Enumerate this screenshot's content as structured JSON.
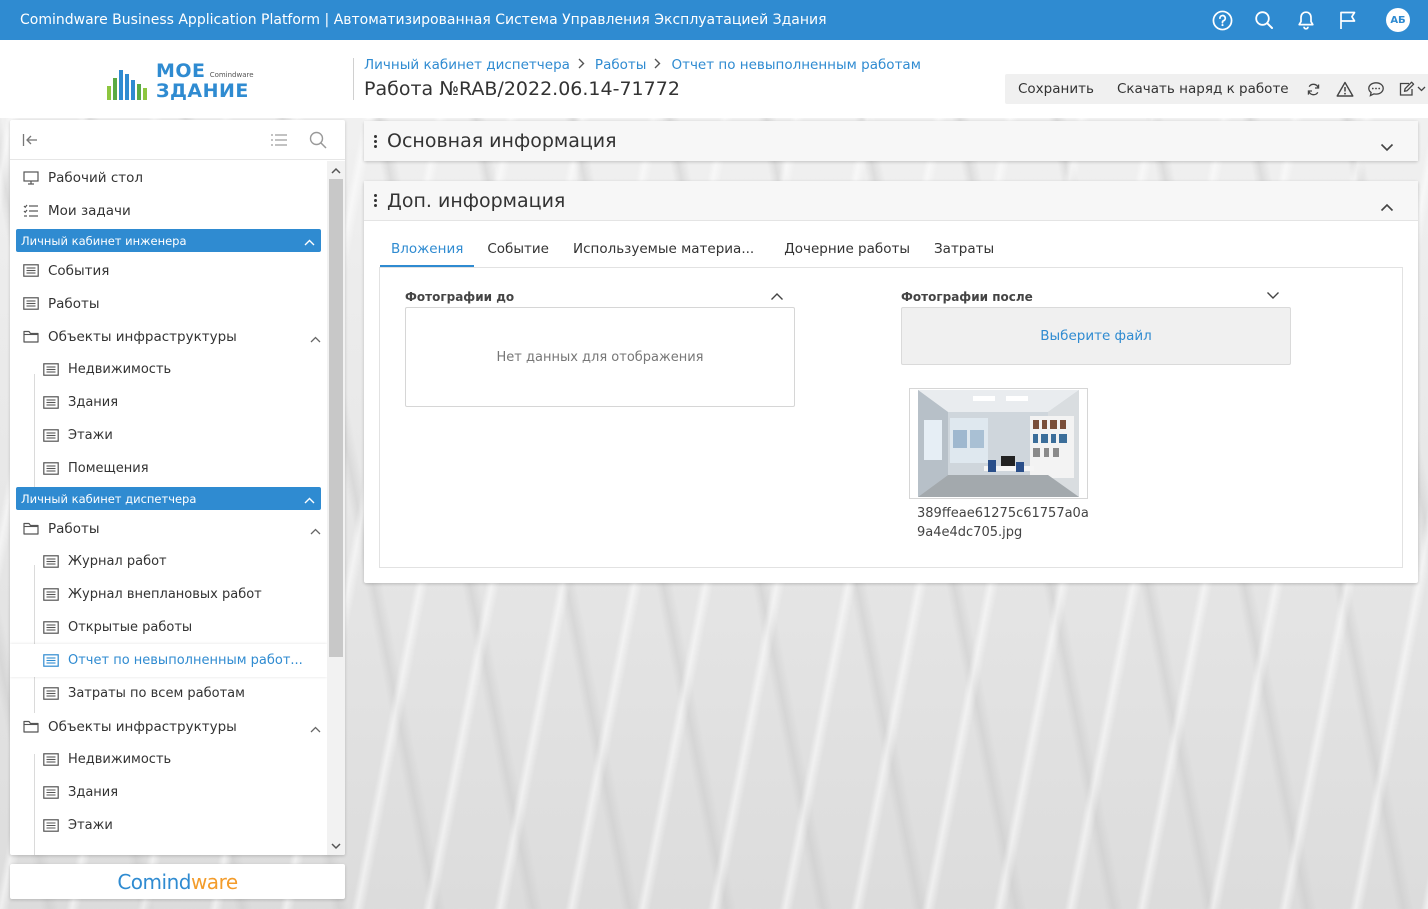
{
  "topbar": {
    "title": "Comindware Business Application Platform  |  Автоматизированная Система Управления Эксплуатацией Здания",
    "avatar": "АБ",
    "icons": [
      "help-icon",
      "search-icon",
      "bell-icon",
      "flag-icon"
    ]
  },
  "logo": {
    "line1": "МОЕ",
    "small": "Comindware",
    "line2": "ЗДАНИЕ"
  },
  "breadcrumb": {
    "items": [
      "Личный кабинет диспетчера",
      "Работы",
      "Отчет по невыполненным работам"
    ]
  },
  "page": {
    "title": "Работа №RAB/2022.06.14-71772"
  },
  "toolbar": {
    "save_label": "Сохранить",
    "download_label": "Скачать наряд к работе",
    "icons": [
      "refresh-icon",
      "warning-icon",
      "comment-icon",
      "edit-icon"
    ]
  },
  "sidebar": {
    "items": [
      {
        "label": "Рабочий стол"
      },
      {
        "label": "Мои задачи"
      },
      {
        "group": "Личный кабинет инженера"
      },
      {
        "label": "События"
      },
      {
        "label": "Работы"
      },
      {
        "label": "Объекты инфраструктуры"
      },
      {
        "label": "Недвижимость"
      },
      {
        "label": "Здания"
      },
      {
        "label": "Этажи"
      },
      {
        "label": "Помещения"
      },
      {
        "group": "Личный кабинет диспетчера"
      },
      {
        "label": "Работы"
      },
      {
        "label": "Журнал работ"
      },
      {
        "label": "Журнал внеплановых работ"
      },
      {
        "label": "Открытые работы"
      },
      {
        "label": "Отчет по невыполненным работ...",
        "active": true
      },
      {
        "label": "Затраты по всем работам"
      },
      {
        "label": "Объекты инфраструктуры"
      },
      {
        "label": "Недвижимость"
      },
      {
        "label": "Здания"
      },
      {
        "label": "Этажи"
      }
    ],
    "footer_logo": {
      "part1": "Comind",
      "part2": "ware"
    }
  },
  "panels": {
    "main_info": "Основная информация",
    "extra_info": "Доп. информация"
  },
  "tabs": [
    "Вложения",
    "Событие",
    "Используемые материа...",
    "Дочерние работы",
    "Затраты"
  ],
  "attachments": {
    "before_label": "Фотографии до",
    "before_empty": "Нет данных для отображения",
    "after_label": "Фотографии после",
    "choose_file": "Выберите файл",
    "file_name": "389ffeae61275c61757a0a9a4e4dc705.jpg"
  },
  "colors": {
    "accent": "#2f8bd1",
    "logo_orange": "#f39c2b"
  }
}
